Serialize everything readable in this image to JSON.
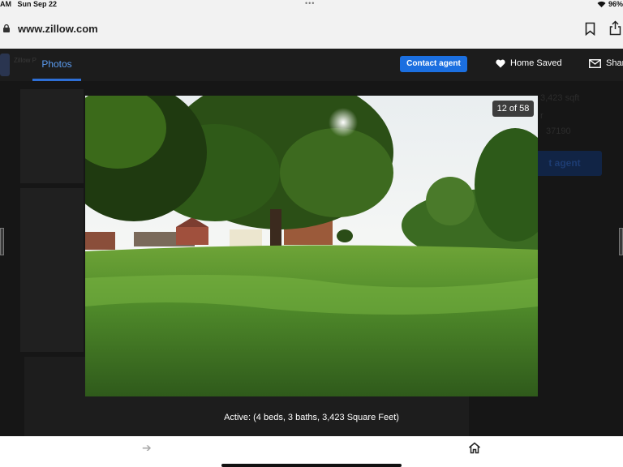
{
  "status": {
    "time": "AM",
    "date": "Sun Sep 22",
    "battery": "96%"
  },
  "browser": {
    "url": "www.zillow.com"
  },
  "nav": {
    "tab_photos": "Photos",
    "contact_label": "Contact agent",
    "home_saved_label": "Home Saved",
    "share_label": "Shar"
  },
  "background": {
    "sqft": "3,423 sqft",
    "line2": "r",
    "zip": "37190",
    "agent_btn": "t agent",
    "ghost": "Zillow P"
  },
  "viewer": {
    "counter": "12 of 58",
    "caption": "Active: (4 beds, 3 baths, 3,423 Square Feet)"
  },
  "icons": [
    "lock-icon",
    "bookmark-icon",
    "share-icon",
    "heart-icon",
    "envelope-icon",
    "forward-arrow-icon",
    "home-icon",
    "wifi-icon"
  ]
}
